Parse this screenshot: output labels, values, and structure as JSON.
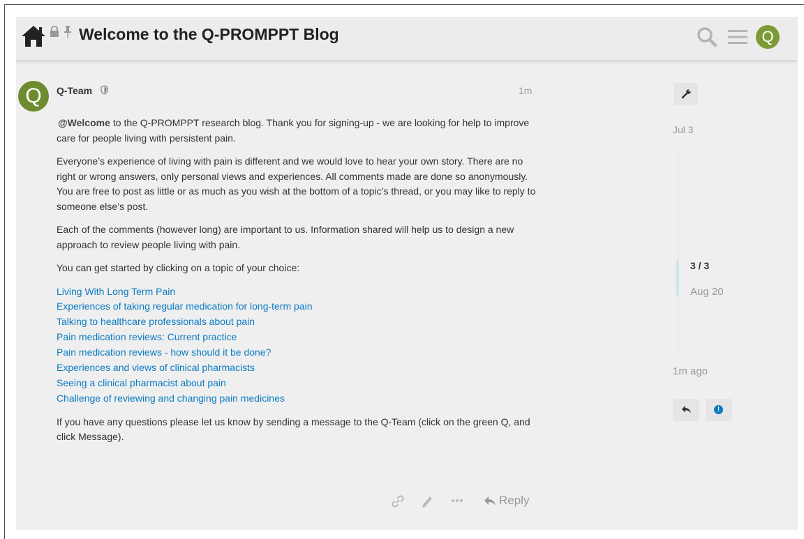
{
  "header": {
    "title": "Welcome to the Q-PROMPPT Blog",
    "avatar_letter": "Q",
    "icons": [
      "home-icon",
      "lock-icon",
      "pin-icon",
      "search-icon",
      "menu-icon"
    ]
  },
  "post": {
    "avatar_letter": "Q",
    "username": "Q-Team",
    "time": "1m",
    "mention": "@Welcome",
    "para1_rest": "to the Q-PROMPPT research blog. Thank you for signing-up - we are looking for help to improve care for people living with persistent pain.",
    "para2": "Everyone’s experience of living with pain is different and we would love to hear your own story. There are no right or wrong answers, only personal views and experiences. All comments made are done so anonymously. You are free to post as little or as much as you wish at the bottom of a topic’s thread, or you may like to reply to someone else’s post.",
    "para3": "Each of the comments (however long) are important to us. Information shared will help us to design a new approach to review people living with pain.",
    "para4": "You can get started by clicking on a topic of your choice:",
    "links": [
      "Living With Long Term Pain",
      "Experiences of taking regular medication for long-term pain",
      "Talking to healthcare professionals about pain",
      "Pain medication reviews: Current practice",
      "Pain medication reviews - how should it be done?",
      "Experiences and views of clinical pharmacists",
      "Seeing a clinical pharmacist about pain",
      "Challenge of reviewing and changing pain medicines"
    ],
    "para5": "If you have any questions please let us know by sending a message to the Q-Team (click on the green Q, and click Message).",
    "actions": {
      "reply_label": "Reply",
      "icons": [
        "link-icon",
        "edit-icon",
        "more-icon",
        "reply-icon"
      ]
    }
  },
  "timeline": {
    "start_date": "Jul 3",
    "counter": "3 / 3",
    "current_date": "Aug 20",
    "last_activity": "1m ago",
    "notify_glyph": "!"
  },
  "colors": {
    "link": "#0a7bc2",
    "avatar": "#7c9a36",
    "background": "#efefef",
    "timeline_rail": "#cfe4f0"
  }
}
